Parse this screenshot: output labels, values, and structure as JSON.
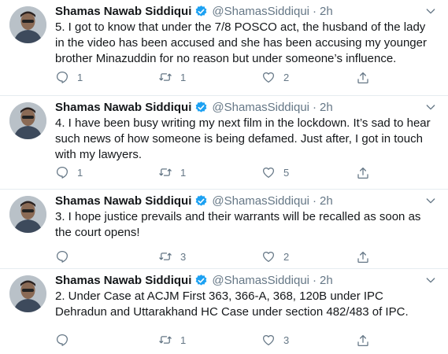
{
  "tweets": [
    {
      "name": "Shamas Nawab Siddiqui",
      "handle": "@ShamasSiddiqui",
      "dot": "·",
      "time": "2h",
      "text": "5. I got to know that under the 7/8 POSCO act, the husband of the lady in the video has been accused and she has been accusing my younger brother Minazuddin for no reason but under someone’s influence.",
      "replies": "1",
      "retweets": "1",
      "likes": "2"
    },
    {
      "name": "Shamas Nawab Siddiqui",
      "handle": "@ShamasSiddiqui",
      "dot": "·",
      "time": "2h",
      "text": "4. I have been busy writing my next film in the lockdown. It’s sad to hear such news of how someone is being defamed. Just after, I got in touch with my lawyers.",
      "replies": "1",
      "retweets": "1",
      "likes": "5"
    },
    {
      "name": "Shamas Nawab Siddiqui",
      "handle": "@ShamasSiddiqui",
      "dot": "·",
      "time": "2h",
      "text": "3. I hope justice prevails and their warrants will be recalled as soon as the court opens!",
      "replies": "",
      "retweets": "3",
      "likes": "2"
    },
    {
      "name": "Shamas Nawab Siddiqui",
      "handle": "@ShamasSiddiqui",
      "dot": "·",
      "time": "2h",
      "text": "2. Under Case at ACJM First 363, 366-A, 368, 120B under IPC Dehradun and Uttarakhand HC Case under section 482/483 of IPC.",
      "replies": "",
      "retweets": "1",
      "likes": "3"
    }
  ],
  "icons": {
    "verified": "verified-badge-icon",
    "caret": "chevron-down-icon",
    "reply": "reply-icon",
    "retweet": "retweet-icon",
    "like": "heart-icon",
    "share": "share-icon"
  },
  "colors": {
    "verified": "#1da1f2",
    "muted": "#657786",
    "text": "#14171a",
    "divider": "#e6ecf0"
  }
}
